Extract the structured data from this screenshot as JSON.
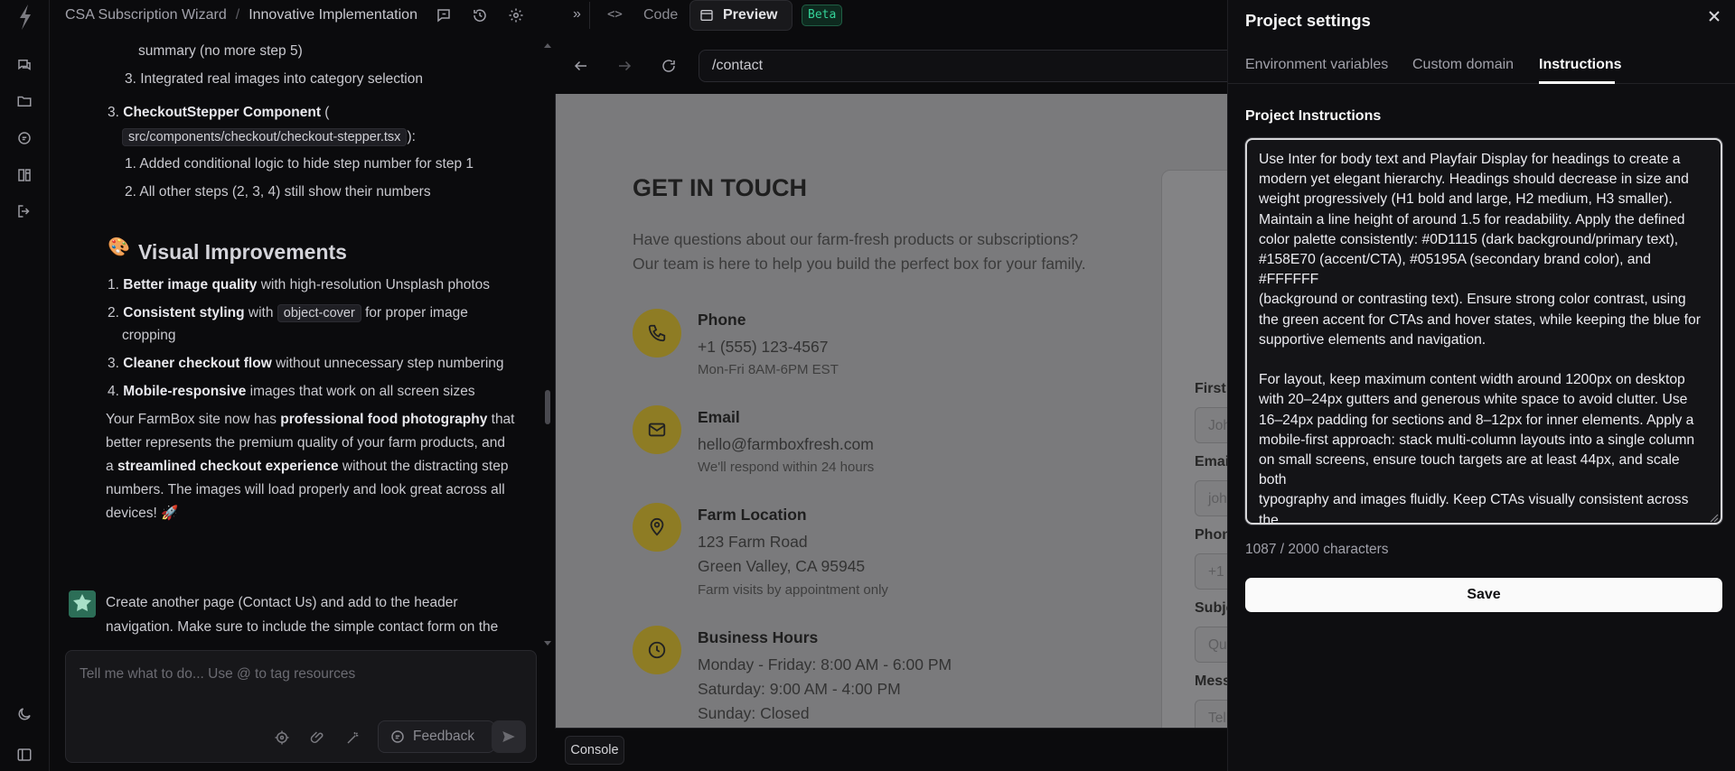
{
  "project": {
    "name": "CSA Subscription Wizard",
    "separator": "/",
    "page": "Innovative Implementation"
  },
  "chat": {
    "lines": {
      "l1": "summary (no more step 5)",
      "l2": "3. Integrated real images into category selection",
      "l3_num": "3.",
      "l3_bold": "CheckoutStepper Component",
      "l3_rest": " (",
      "l4_code": "src/components/checkout/checkout-stepper.tsx",
      "l4_rest": "):",
      "l5": "1. Added conditional logic to hide step number for step 1",
      "l6": "2. All other steps (2, 3, 4) still show their numbers",
      "heading": "Visual Improvements",
      "heading_emoji": "🎨",
      "v1_num": "1.",
      "v1_bold": "Better image quality",
      "v1_rest": " with high-resolution Unsplash photos",
      "v2_num": "2.",
      "v2_bold": "Consistent styling",
      "v2_mid": " with ",
      "v2_code": "object-cover",
      "v2_rest": " for proper image",
      "v2_line2": "cropping",
      "v3_num": "3.",
      "v3_bold": "Cleaner checkout flow",
      "v3_rest": " without unnecessary step numbering",
      "v4_num": "4.",
      "v4_bold": "Mobile-responsive",
      "v4_rest": " images that work on all screen sizes",
      "p1_a": "Your FarmBox site now has ",
      "p1_b": "professional food photography",
      "p1_c": " that",
      "p2": "better represents the premium quality of your farm products, and",
      "p3_a": "a ",
      "p3_b": "streamlined checkout experience",
      "p3_c": " without the distracting step",
      "p4": "numbers. The images will load properly and look great across all",
      "p5": "devices! 🚀"
    },
    "user_message": {
      "line1": "Create another page (Contact Us) and add to the header",
      "line2": "navigation. Make sure to include the simple contact form on the"
    },
    "input_placeholder": "Tell me what to do... Use @ to tag resources",
    "feedback_label": "Feedback"
  },
  "preview": {
    "tabs": {
      "code": "Code",
      "preview": "Preview",
      "beta": "Beta"
    },
    "url": "/contact",
    "page": {
      "title": "GET IN TOUCH",
      "intro1": "Have questions about our farm-fresh products or subscriptions?",
      "intro2": "Our team is here to help you build the perfect box for your family.",
      "contacts": [
        {
          "label": "Phone",
          "value1": "+1 (555) 123-4567",
          "value2": "",
          "note": "Mon-Fri 8AM-6PM EST"
        },
        {
          "label": "Email",
          "value1": "hello@farmboxfresh.com",
          "value2": "",
          "note": "We'll respond within 24 hours"
        },
        {
          "label": "Farm Location",
          "value1": "123 Farm Road",
          "value2": "Green Valley, CA 95945",
          "note": "Farm visits by appointment only"
        },
        {
          "label": "Business Hours",
          "value1": "Monday - Friday: 8:00 AM - 6:00 PM",
          "value2": "Saturday: 9:00 AM - 4:00 PM",
          "note": "Sunday: Closed"
        }
      ],
      "form": {
        "first_label": "First",
        "first_ph": "Joh",
        "email_label": "Emai",
        "email_ph": "joh",
        "phone_label": "Phon",
        "phone_ph": "+1",
        "subject_label": "Subje",
        "subject_ph": "Qu",
        "message_label": "Mess",
        "message_ph": "Tell"
      }
    },
    "console_label": "Console"
  },
  "settings": {
    "title": "Project settings",
    "tabs": [
      "Environment variables",
      "Custom domain",
      "Instructions"
    ],
    "active_tab": "Instructions",
    "instructions_label": "Project Instructions",
    "instructions_text": "Use Inter for body text and Playfair Display for headings to create a\nmodern yet elegant hierarchy. Headings should decrease in size and\nweight progressively (H1 bold and large, H2 medium, H3 smaller).\nMaintain a line height of around 1.5 for readability. Apply the defined\ncolor palette consistently: #0D1115 (dark background/primary text),\n#158E70 (accent/CTA), #05195A (secondary brand color), and #FFFFFF\n(background or contrasting text). Ensure strong color contrast, using\nthe green accent for CTAs and hover states, while keeping the blue for\nsupportive elements and navigation.\n\nFor layout, keep maximum content width around 1200px on desktop\nwith 20–24px gutters and generous white space to avoid clutter. Use\n16–24px padding for sections and 8–12px for inner elements. Apply a\nmobile-first approach: stack multi-column layouts into a single column\non small screens, ensure touch targets are at least 44px, and scale both\ntypography and images fluidly. Keep CTAs visually consistent across the\nsite and align all elements to a grid system to maintain balance and\nresponsiveness.",
    "char_count": "1087 / 2000 characters",
    "save_label": "Save"
  },
  "colors": {
    "accent_icon": "#8e7c24",
    "badge": "#34d399",
    "panel": "#0e0e11"
  }
}
